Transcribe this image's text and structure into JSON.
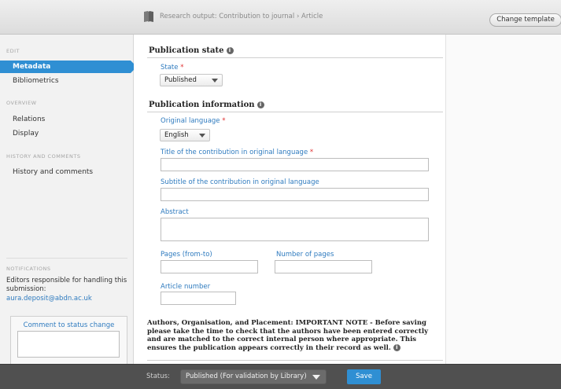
{
  "header": {
    "title": "Research output: Contribution to journal › Article",
    "change_template_label": "Change template",
    "book_icon": "book-icon"
  },
  "sidebar": {
    "edit_heading": "EDIT",
    "edit_items": [
      {
        "label": "Metadata"
      },
      {
        "label": "Bibliometrics"
      }
    ],
    "overview_heading": "OVERVIEW",
    "overview_items": [
      {
        "label": "Relations"
      },
      {
        "label": "Display"
      }
    ],
    "history_heading": "HISTORY AND COMMENTS",
    "history_items": [
      {
        "label": "History and comments"
      }
    ],
    "notifications_heading": "NOTIFICATIONS",
    "notification_text": "Editors responsible for handling this submission:",
    "notification_email": "aura.deposit@abdn.ac.uk",
    "comment_label": "Comment to status change"
  },
  "form": {
    "publication_state_title": "Publication state",
    "state_label": "State",
    "state_value": "Published",
    "publication_info_title": "Publication information",
    "original_language_label": "Original language",
    "original_language_value": "English",
    "title_label": "Title of the contribution in original language",
    "subtitle_label": "Subtitle of the contribution in original language",
    "abstract_label": "Abstract",
    "pages_label": "Pages (from-to)",
    "number_of_pages_label": "Number of pages",
    "article_number_label": "Article number",
    "required_mark": "*",
    "note": "Authors, Organisation, and Placement: IMPORTANT NOTE - Before saving please take the time to check that the authors have been entered correctly and are matched to the correct internal person where appropriate. This ensures the publication appears correctly in their record as well."
  },
  "footer": {
    "status_label": "Status:",
    "status_value": "Published (For validation by Library)",
    "save_label": "Save"
  },
  "colors": {
    "accent": "#2f8fd3",
    "link": "#2f7bbf",
    "required": "#e03030",
    "footer_bg": "#505050"
  }
}
